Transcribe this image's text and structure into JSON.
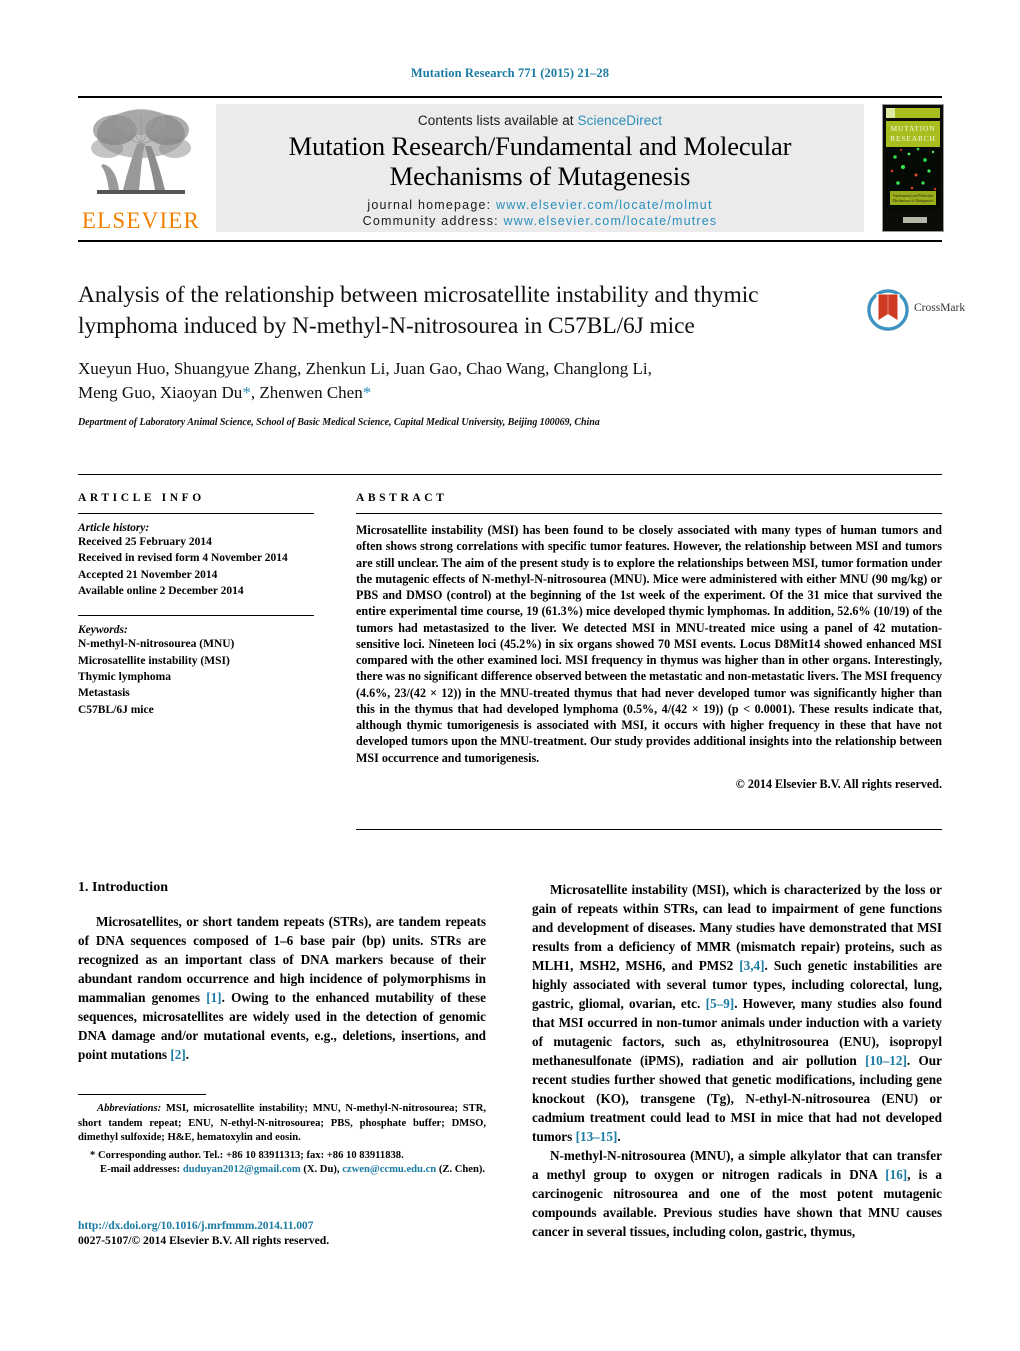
{
  "running_head": "Mutation Research 771 (2015) 21–28",
  "masthead": {
    "contents_prefix": "Contents lists available at ",
    "sciencedirect": "ScienceDirect",
    "journal_title_line1": "Mutation Research/Fundamental and Molecular",
    "journal_title_line2": "Mechanisms of Mutagenesis",
    "homepage_label": "journal homepage:",
    "homepage_url": "www.elsevier.com/locate/molmut",
    "community_label": "Community address:",
    "community_url": "www.elsevier.com/locate/mutres",
    "publisher_name": "ELSEVIER",
    "publisher_logo_icon": "elsevier-tree-icon",
    "cover_title_line1": "MUTATION",
    "cover_title_line2": "RESEARCH",
    "cover_subtitle": "Fundamental and Molecular Mechanisms of Mutagenesis",
    "accent_link_color": "#2a8fbd",
    "elsevier_orange": "#F08000"
  },
  "article": {
    "title": "Analysis of the relationship between microsatellite instability and thymic lymphoma induced by N-methyl-N-nitrosourea in C57BL/6J mice",
    "authors": "Xueyun Huo, Shuangyue Zhang, Zhenkun Li, Juan Gao, Chao Wang, Changlong Li, Meng Guo, Xiaoyan Du",
    "authors_line1": "Xueyun Huo, Shuangyue Zhang, Zhenkun Li, Juan Gao, Chao Wang, Changlong Li,",
    "authors_line2_a": "Meng Guo, Xiaoyan Du",
    "authors_line2_b": ", Zhenwen Chen",
    "corresponding_marker": "*",
    "affiliation": "Department of Laboratory Animal Science, School of Basic Medical Science, Capital Medical University, Beijing 100069, China",
    "crossmark_label": "CrossMark"
  },
  "article_info": {
    "heading": "ARTICLE INFO",
    "history_label": "Article history:",
    "history": [
      "Received 25 February 2014",
      "Received in revised form 4 November 2014",
      "Accepted 21 November 2014",
      "Available online 2 December 2014"
    ],
    "keywords_label": "Keywords:",
    "keywords": [
      "N-methyl-N-nitrosourea (MNU)",
      "Microsatellite instability (MSI)",
      "Thymic lymphoma",
      "Metastasis",
      "C57BL/6J mice"
    ]
  },
  "abstract": {
    "heading": "ABSTRACT",
    "text": "Microsatellite instability (MSI) has been found to be closely associated with many types of human tumors and often shows strong correlations with specific tumor features. However, the relationship between MSI and tumors are still unclear. The aim of the present study is to explore the relationships between MSI, tumor formation under the mutagenic effects of N-methyl-N-nitrosourea (MNU). Mice were administered with either MNU (90 mg/kg) or PBS and DMSO (control) at the beginning of the 1st week of the experiment. Of the 31 mice that survived the entire experimental time course, 19 (61.3%) mice developed thymic lymphomas. In addition, 52.6% (10/19) of the tumors had metastasized to the liver. We detected MSI in MNU-treated mice using a panel of 42 mutation-sensitive loci. Nineteen loci (45.2%) in six organs showed 70 MSI events. Locus D8Mit14 showed enhanced MSI compared with the other examined loci. MSI frequency in thymus was higher than in other organs. Interestingly, there was no significant difference observed between the metastatic and non-metastatic livers. The MSI frequency (4.6%, 23/(42 × 12)) in the MNU-treated thymus that had never developed tumor was significantly higher than this in the thymus that had developed lymphoma (0.5%, 4/(42 × 19)) (p < 0.0001). These results indicate that, although thymic tumorigenesis is associated with MSI, it occurs with higher frequency in these that have not developed tumors upon the MNU-treatment. Our study provides additional insights into the relationship between MSI occurrence and tumorigenesis.",
    "copyright": "© 2014 Elsevier B.V. All rights reserved."
  },
  "introduction": {
    "heading": "1. Introduction",
    "left_p1_a": "Microsatellites, or short tandem repeats (STRs), are tandem repeats of DNA sequences composed of 1–6 base pair (bp) units. STRs are recognized as an important class of DNA markers because of their abundant random occurrence and high incidence of polymorphisms in mammalian genomes ",
    "left_p1_ref1": "[1]",
    "left_p1_b": ". Owing to the enhanced mutability of these sequences, microsatellites are widely used in the detection of genomic DNA damage and/or mutational events, e.g., deletions, insertions, and point mutations ",
    "left_p1_ref2": "[2]",
    "left_p1_c": ".",
    "right_p1_a": "Microsatellite instability (MSI), which is characterized by the loss or gain of repeats within STRs, can lead to impairment of gene functions and development of diseases. Many studies have demonstrated that MSI results from a deficiency of MMR (mismatch repair) proteins, such as MLH1, MSH2, MSH6, and PMS2 ",
    "right_p1_ref1": "[3,4]",
    "right_p1_b": ". Such genetic instabilities are highly associated with several tumor types, including colorectal, lung, gastric, gliomal, ovarian, etc. ",
    "right_p1_ref2": "[5–9]",
    "right_p1_c": ". However, many studies also found that MSI occurred in non-tumor animals under induction with a variety of mutagenic factors, such as, ethylnitrosourea (ENU), isopropyl methanesulfonate (iPMS), radiation and air pollution ",
    "right_p1_ref3": "[10–12]",
    "right_p1_d": ". Our recent studies further showed that genetic modifications, including gene knockout (KO), transgene (Tg), N-ethyl-N-nitrosourea (ENU) or cadmium treatment could lead to MSI in mice that had not developed tumors ",
    "right_p1_ref4": "[13–15]",
    "right_p1_e": ".",
    "right_p2_a": "N-methyl-N-nitrosourea (MNU), a simple alkylator that can transfer a methyl group to oxygen or nitrogen radicals in DNA ",
    "right_p2_ref1": "[16]",
    "right_p2_b": ", is a carcinogenic nitrosourea and one of the most potent mutagenic compounds available. Previous studies have shown that MNU causes cancer in several tissues, including colon, gastric, thymus,"
  },
  "footnotes": {
    "abbreviations_label": "Abbreviations:",
    "abbreviations_text": " MSI, microsatellite instability; MNU, N-methyl-N-nitrosourea; STR, short tandem repeat; ENU, N-ethyl-N-nitrosourea; PBS, phosphate buffer; DMSO, dimethyl sulfoxide; H&E, hematoxylin and eosin.",
    "corresponding_marker": "*",
    "corresponding_text": " Corresponding author. Tel.: +86 10 83911313; fax: +86 10 83911838.",
    "email_label": "E-mail addresses:",
    "email1": "duduyan2012@gmail.com",
    "email1_owner": " (X. Du), ",
    "email2": "czwen@ccmu.edu.cn",
    "email2_owner": "(Z. Chen).",
    "doi": "http://dx.doi.org/10.1016/j.mrfmmm.2014.11.007",
    "issn_line": "0027-5107/© 2014 Elsevier B.V. All rights reserved."
  }
}
